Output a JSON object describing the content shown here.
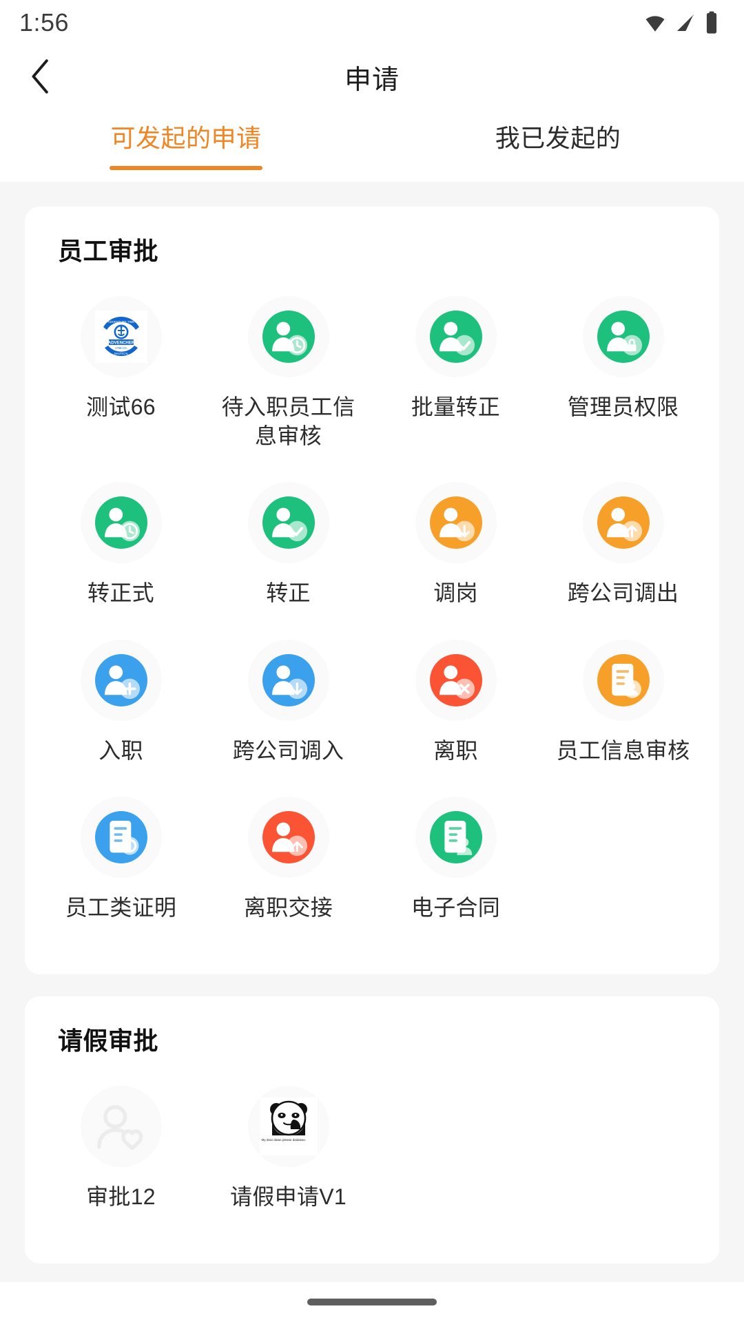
{
  "status_bar": {
    "time": "1:56",
    "icons": [
      "wifi-icon",
      "signal-icon",
      "battery-icon"
    ]
  },
  "nav": {
    "back_icon": "chevron-left-icon",
    "title": "申请"
  },
  "tabs": [
    {
      "label": "可发起的申请",
      "active": true
    },
    {
      "label": "我已发起的",
      "active": false
    }
  ],
  "colors": {
    "accent": "#ef8623",
    "green": "#1ec07e",
    "orange": "#f7a029",
    "blue": "#3ba1ed",
    "red": "#fb5434",
    "logo_blue": "#1266cc",
    "page_bg": "#f6f6f6",
    "card_bg": "#ffffff",
    "icon_circle_bg": "#fafafa",
    "text": "#2c2c2c",
    "muted": "#ececec"
  },
  "sections": [
    {
      "title": "员工审批",
      "items": [
        {
          "label": "测试66",
          "icon": "company-logo-badge-icon",
          "style": "logo",
          "color": "#1266cc"
        },
        {
          "label": "待入职员工信息审核",
          "icon": "person-clock-icon",
          "style": "badge",
          "color": "#1ec07e"
        },
        {
          "label": "批量转正",
          "icon": "person-check-icon",
          "style": "badge",
          "color": "#1ec07e"
        },
        {
          "label": "管理员权限",
          "icon": "person-lock-icon",
          "style": "badge",
          "color": "#1ec07e"
        },
        {
          "label": "转正式",
          "icon": "person-clock-icon",
          "style": "badge",
          "color": "#1ec07e"
        },
        {
          "label": "转正",
          "icon": "person-check-icon",
          "style": "badge",
          "color": "#1ec07e"
        },
        {
          "label": "调岗",
          "icon": "person-transfer-icon",
          "style": "badge",
          "color": "#f7a029"
        },
        {
          "label": "跨公司调出",
          "icon": "person-out-icon",
          "style": "badge",
          "color": "#f7a029"
        },
        {
          "label": "入职",
          "icon": "person-add-icon",
          "style": "badge",
          "color": "#3ba1ed"
        },
        {
          "label": "跨公司调入",
          "icon": "person-in-icon",
          "style": "badge",
          "color": "#3ba1ed"
        },
        {
          "label": "离职",
          "icon": "person-remove-icon",
          "style": "badge",
          "color": "#fb5434"
        },
        {
          "label": "员工信息审核",
          "icon": "document-edit-icon",
          "style": "badge",
          "color": "#f7a029"
        },
        {
          "label": "员工类证明",
          "icon": "document-seal-icon",
          "style": "badge",
          "color": "#3ba1ed"
        },
        {
          "label": "离职交接",
          "icon": "person-handover-icon",
          "style": "badge",
          "color": "#fb5434"
        },
        {
          "label": "电子合同",
          "icon": "document-contract-icon",
          "style": "badge",
          "color": "#1ec07e"
        }
      ]
    },
    {
      "title": "请假审批",
      "items": [
        {
          "label": "审批12",
          "icon": "person-heart-outline-icon",
          "style": "outline",
          "color": "#ececec"
        },
        {
          "label": "请假申请V1",
          "icon": "panda-meme-icon",
          "style": "panda",
          "color": "#1a1a1a",
          "caption": "My dear dalao please daidaiwo."
        }
      ]
    }
  ],
  "logo": {
    "top_text": "ADVENTURE TIME",
    "center_text": "ADVENCHER",
    "sub_text": "1799 CO.",
    "bottom_text": "NAUTICAL"
  },
  "home_indicator": "home-indicator"
}
